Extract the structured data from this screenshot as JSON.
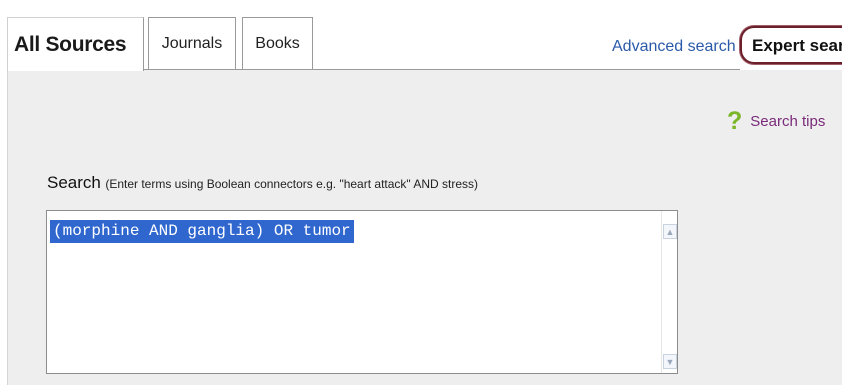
{
  "tabs": [
    {
      "label": "All Sources",
      "selected": true
    },
    {
      "label": "Journals",
      "selected": false
    },
    {
      "label": "Books",
      "selected": false
    }
  ],
  "links": {
    "advanced": "Advanced search",
    "expert": "Expert searc"
  },
  "tips": {
    "icon": "question-mark-icon",
    "label": "Search tips"
  },
  "search": {
    "title": "Search",
    "hint": "(Enter terms using Boolean connectors e.g. \"heart attack\" AND stress)",
    "query": "(morphine AND ganglia) OR tumor"
  },
  "colors": {
    "link": "#2a5aa8",
    "tips_link": "#7a2a7a",
    "tips_icon": "#7bb629",
    "selection": "#2f67cf",
    "expert_highlight": "#6b1f2b"
  }
}
